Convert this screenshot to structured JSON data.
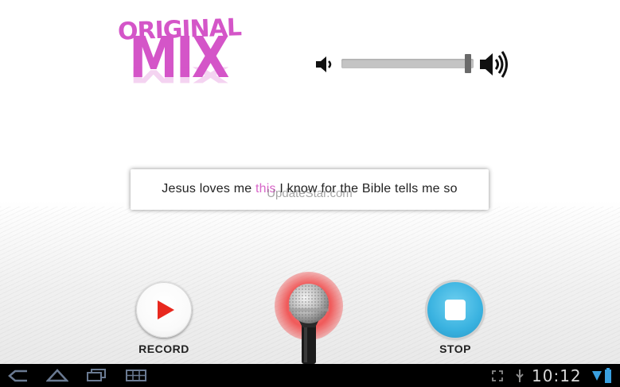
{
  "logo": {
    "line1": "ORIGINAL",
    "line2": "MIX",
    "color": "#d455c8"
  },
  "volume": {
    "level": 0.98,
    "low_icon": "speaker-low-icon",
    "high_icon": "speaker-high-icon"
  },
  "lyrics": {
    "before": "Jesus loves me ",
    "highlight": "this",
    "after": " I know for the Bible tells me so",
    "highlight_color": "#d866c9"
  },
  "watermark": "UpdateStar.com",
  "controls": {
    "record_label": "RECORD",
    "stop_label": "STOP",
    "mic_icon": "microphone-icon"
  },
  "system_bar": {
    "time": "10:12",
    "icons": [
      "back-icon",
      "home-icon",
      "recent-apps-icon",
      "menu-icon",
      "screen-compat-icon",
      "usb-icon",
      "signal-icon",
      "battery-icon"
    ]
  }
}
